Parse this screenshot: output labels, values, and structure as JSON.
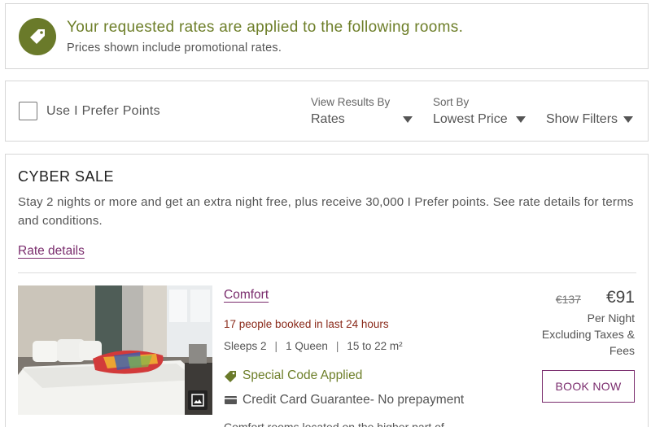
{
  "banner": {
    "title": "Your requested rates are applied to the following rooms.",
    "subtitle": "Prices shown include promotional rates.",
    "icon": "price-tag-icon",
    "accent_color": "#6a7a2a"
  },
  "filters": {
    "prefer_points_label": "Use I Prefer Points",
    "prefer_points_checked": false,
    "view_results_label": "View Results By",
    "view_results_value": "Rates",
    "sort_label": "Sort By",
    "sort_value": "Lowest Price",
    "show_filters_label": "Show Filters"
  },
  "offer": {
    "title": "CYBER SALE",
    "description": "Stay 2 nights or more and get an extra night free, plus receive 30,000 I Prefer points. See rate details for terms and conditions.",
    "rate_details_link": "Rate details",
    "room": {
      "name": "Comfort",
      "booked_notice": "17 people booked in last 24 hours",
      "sleeps": "Sleeps 2",
      "bed": "1 Queen",
      "size": "15 to 22 m²",
      "perks": [
        {
          "label": "Special Code Applied",
          "icon": "tag-icon"
        },
        {
          "label": "Credit Card Guarantee- No prepayment",
          "icon": "credit-card-icon"
        }
      ],
      "price_old": "€137",
      "price_new": "€91",
      "price_lines": [
        "Per Night",
        "Excluding Taxes &",
        "Fees"
      ],
      "book_label": "BOOK NOW",
      "partial_text": "Comfort rooms located on the higher part of"
    },
    "brand_color": "#7a2c6d"
  }
}
